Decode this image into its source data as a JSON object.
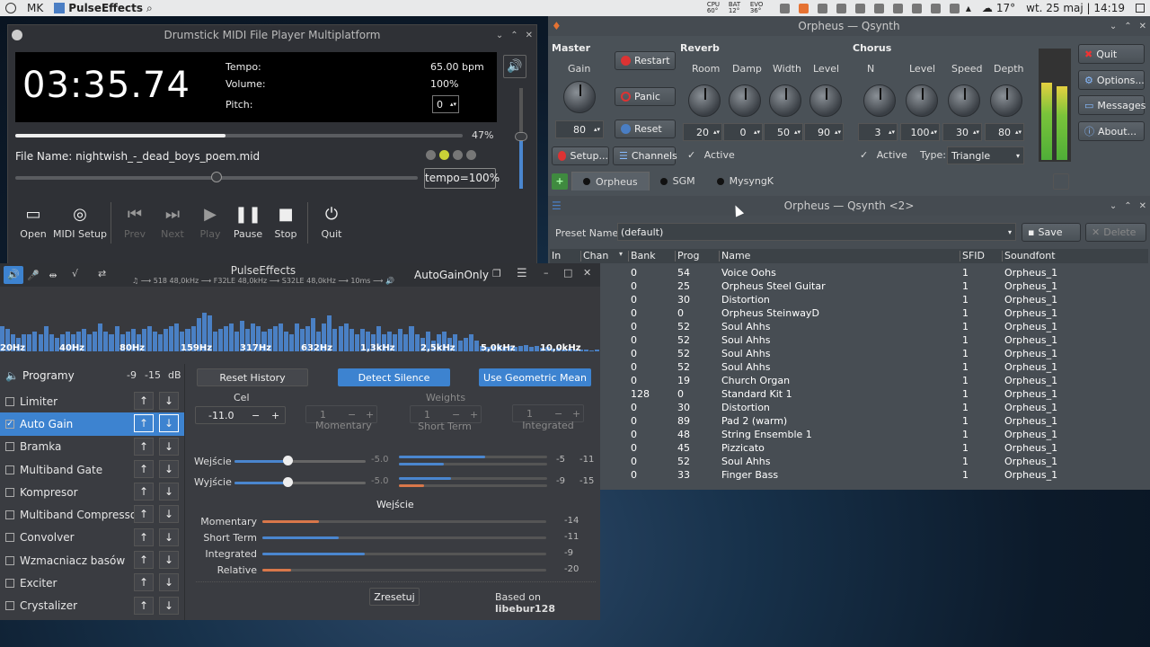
{
  "topbar": {
    "user": "MK",
    "app": "PulseEffects",
    "temps": [
      "CPU 60°",
      "BAT 12°",
      "EVO 36°"
    ],
    "temp_label": "17°",
    "datetime": "wt. 25 maj | 14:19"
  },
  "drumstick": {
    "title": "Drumstick MIDI File Player Multiplatform",
    "time": "03:35.74",
    "tempo_label": "Tempo:",
    "tempo_value": "65.00 bpm",
    "volume_label": "Volume:",
    "volume_value": "100%",
    "pitch_label": "Pitch:",
    "pitch_value": "0",
    "progress": 0.47,
    "progress_text": "47%",
    "file_label": "File Name:",
    "file_name": "nightwish_-_dead_boys_poem.mid",
    "tempo_slider": 0.5,
    "tempo_box": "tempo=100%",
    "volume_level": 0.52,
    "buttons": [
      {
        "label": "Open",
        "icon": "folder-icon",
        "enabled": true
      },
      {
        "label": "MIDI Setup",
        "icon": "settings-icon",
        "enabled": true
      },
      {
        "label": "Prev",
        "icon": "skip-back-icon",
        "enabled": false
      },
      {
        "label": "Next",
        "icon": "skip-forward-icon",
        "enabled": false
      },
      {
        "label": "Play",
        "icon": "play-icon",
        "enabled": false
      },
      {
        "label": "Pause",
        "icon": "pause-icon",
        "enabled": true
      },
      {
        "label": "Stop",
        "icon": "stop-icon",
        "enabled": true
      },
      {
        "label": "Quit",
        "icon": "power-icon",
        "enabled": true
      }
    ]
  },
  "pulse": {
    "title": "PulseEffects",
    "subtitle": "♫ ⟶ 518 48,0kHz ⟶ F32LE 48,0kHz ⟶ S32LE 48,0kHz ⟶ 10ms ⟶ 🔊",
    "preset": "AutoGainOnly",
    "freq_labels": [
      "20Hz",
      "40Hz",
      "80Hz",
      "159Hz",
      "317Hz",
      "632Hz",
      "1,3kHz",
      "2,5kHz",
      "5,0kHz",
      "10,0kHz"
    ],
    "spectrum": [
      0.45,
      0.4,
      0.3,
      0.25,
      0.3,
      0.3,
      0.35,
      0.3,
      0.45,
      0.3,
      0.25,
      0.3,
      0.35,
      0.3,
      0.35,
      0.4,
      0.3,
      0.35,
      0.5,
      0.35,
      0.3,
      0.45,
      0.3,
      0.35,
      0.4,
      0.3,
      0.4,
      0.45,
      0.35,
      0.3,
      0.4,
      0.45,
      0.5,
      0.35,
      0.4,
      0.45,
      0.6,
      0.7,
      0.65,
      0.35,
      0.4,
      0.45,
      0.5,
      0.35,
      0.55,
      0.4,
      0.5,
      0.45,
      0.35,
      0.4,
      0.45,
      0.5,
      0.35,
      0.3,
      0.5,
      0.4,
      0.45,
      0.6,
      0.35,
      0.5,
      0.65,
      0.4,
      0.45,
      0.5,
      0.4,
      0.3,
      0.4,
      0.35,
      0.3,
      0.45,
      0.3,
      0.35,
      0.3,
      0.4,
      0.3,
      0.45,
      0.3,
      0.25,
      0.35,
      0.2,
      0.3,
      0.35,
      0.25,
      0.3,
      0.2,
      0.25,
      0.3,
      0.2,
      0.1,
      0.08,
      0.1,
      0.12,
      0.08,
      0.1,
      0.08,
      0.1,
      0.12,
      0.08,
      0.1,
      0.06,
      0.08,
      0.05,
      0.06,
      0.04,
      0.05,
      0.03,
      0.04,
      0.03,
      0.02,
      0.03
    ],
    "program_label": "Programy",
    "db_values": [
      "-9",
      "-15",
      "dB"
    ],
    "plugins": [
      {
        "name": "Limiter",
        "checked": false
      },
      {
        "name": "Auto Gain",
        "checked": true
      },
      {
        "name": "Bramka",
        "checked": false
      },
      {
        "name": "Multiband Gate",
        "checked": false
      },
      {
        "name": "Kompresor",
        "checked": false
      },
      {
        "name": "Multiband Compressor",
        "checked": false
      },
      {
        "name": "Convolver",
        "checked": false
      },
      {
        "name": "Wzmacniacz basów",
        "checked": false
      },
      {
        "name": "Exciter",
        "checked": false
      },
      {
        "name": "Crystalizer",
        "checked": false
      }
    ],
    "reset_history": "Reset History",
    "detect_silence": "Detect Silence",
    "geometric_mean": "Use Geometric Mean",
    "target_label": "Cel",
    "target_value": "-11.0",
    "weights_label": "Weights",
    "momentary_label": "Momentary",
    "short_term_label": "Short Term",
    "integrated_label": "Integrated",
    "weight_values": [
      "1",
      "1",
      "1"
    ],
    "input_label": "Wejście",
    "input_value": "-5.0",
    "input_slider": 0.56,
    "input_meters": [
      "-5",
      "-11"
    ],
    "input_levels": [
      0.58,
      0.3
    ],
    "output_label": "Wyjście",
    "output_value": "-5.0",
    "output_slider": 0.56,
    "output_meters": [
      "-9",
      "-15"
    ],
    "output_levels": [
      0.35,
      0.17
    ],
    "section_label": "Wejście",
    "loudness": [
      {
        "label": "Momentary",
        "value": "-14",
        "level": 0.2,
        "color": "#d9774a"
      },
      {
        "label": "Short Term",
        "value": "-11",
        "level": 0.27,
        "color": "#4a86cf"
      },
      {
        "label": "Integrated",
        "value": "-9",
        "level": 0.36,
        "color": "#4a86cf"
      },
      {
        "label": "Relative",
        "value": "-20",
        "level": 0.1,
        "color": "#d9774a"
      }
    ],
    "reset_button": "Zresetuj",
    "based_on": "Based on",
    "library": "libebur128"
  },
  "qsynth": {
    "title": "Orpheus — Qsynth",
    "master": "Master",
    "gain": "Gain",
    "gain_value": "80",
    "restart": "Restart",
    "panic": "Panic",
    "reset": "Reset",
    "setup": "Setup...",
    "channels": "Channels",
    "reverb": "Reverb",
    "reverb_labels": [
      "Room",
      "Damp",
      "Width",
      "Level"
    ],
    "reverb_values": [
      "20",
      "0",
      "50",
      "90"
    ],
    "reverb_active": "Active",
    "chorus": "Chorus",
    "chorus_labels": [
      "N",
      "Level",
      "Speed",
      "Depth"
    ],
    "chorus_values": [
      "3",
      "100",
      "30",
      "80"
    ],
    "chorus_active": "Active",
    "type_label": "Type:",
    "type_value": "Triangle",
    "quit": "Quit",
    "options": "Options...",
    "messages": "Messages",
    "about": "About...",
    "tabs": [
      "Orpheus",
      "SGM",
      "MysyngK"
    ],
    "meter_levels": [
      0.72,
      0.68
    ]
  },
  "qsynth2": {
    "title": "Orpheus — Qsynth <2>",
    "preset_label": "Preset Name:",
    "preset_value": "(default)",
    "save": "Save",
    "delete": "Delete",
    "columns": [
      "In",
      "Chan",
      "Bank",
      "Prog",
      "Name",
      "SFID",
      "Soundfont"
    ],
    "rows": [
      [
        "0",
        "54",
        "Voice Oohs",
        "1",
        "Orpheus_1"
      ],
      [
        "0",
        "25",
        "Orpheus Steel Guitar",
        "1",
        "Orpheus_1"
      ],
      [
        "0",
        "30",
        "Distortion",
        "1",
        "Orpheus_1"
      ],
      [
        "0",
        "0",
        "Orpheus SteinwayD",
        "1",
        "Orpheus_1"
      ],
      [
        "0",
        "52",
        "Soul Ahhs",
        "1",
        "Orpheus_1"
      ],
      [
        "0",
        "52",
        "Soul Ahhs",
        "1",
        "Orpheus_1"
      ],
      [
        "0",
        "52",
        "Soul Ahhs",
        "1",
        "Orpheus_1"
      ],
      [
        "0",
        "52",
        "Soul Ahhs",
        "1",
        "Orpheus_1"
      ],
      [
        "0",
        "19",
        "Church Organ",
        "1",
        "Orpheus_1"
      ],
      [
        "128",
        "0",
        "Standard Kit 1",
        "1",
        "Orpheus_1"
      ],
      [
        "0",
        "30",
        "Distortion",
        "1",
        "Orpheus_1"
      ],
      [
        "0",
        "89",
        "Pad 2 (warm)",
        "1",
        "Orpheus_1"
      ],
      [
        "0",
        "48",
        "String Ensemble 1",
        "1",
        "Orpheus_1"
      ],
      [
        "0",
        "45",
        "Pizzicato",
        "1",
        "Orpheus_1"
      ],
      [
        "0",
        "52",
        "Soul Ahhs",
        "1",
        "Orpheus_1"
      ],
      [
        "0",
        "33",
        "Finger Bass",
        "1",
        "Orpheus_1"
      ]
    ]
  }
}
